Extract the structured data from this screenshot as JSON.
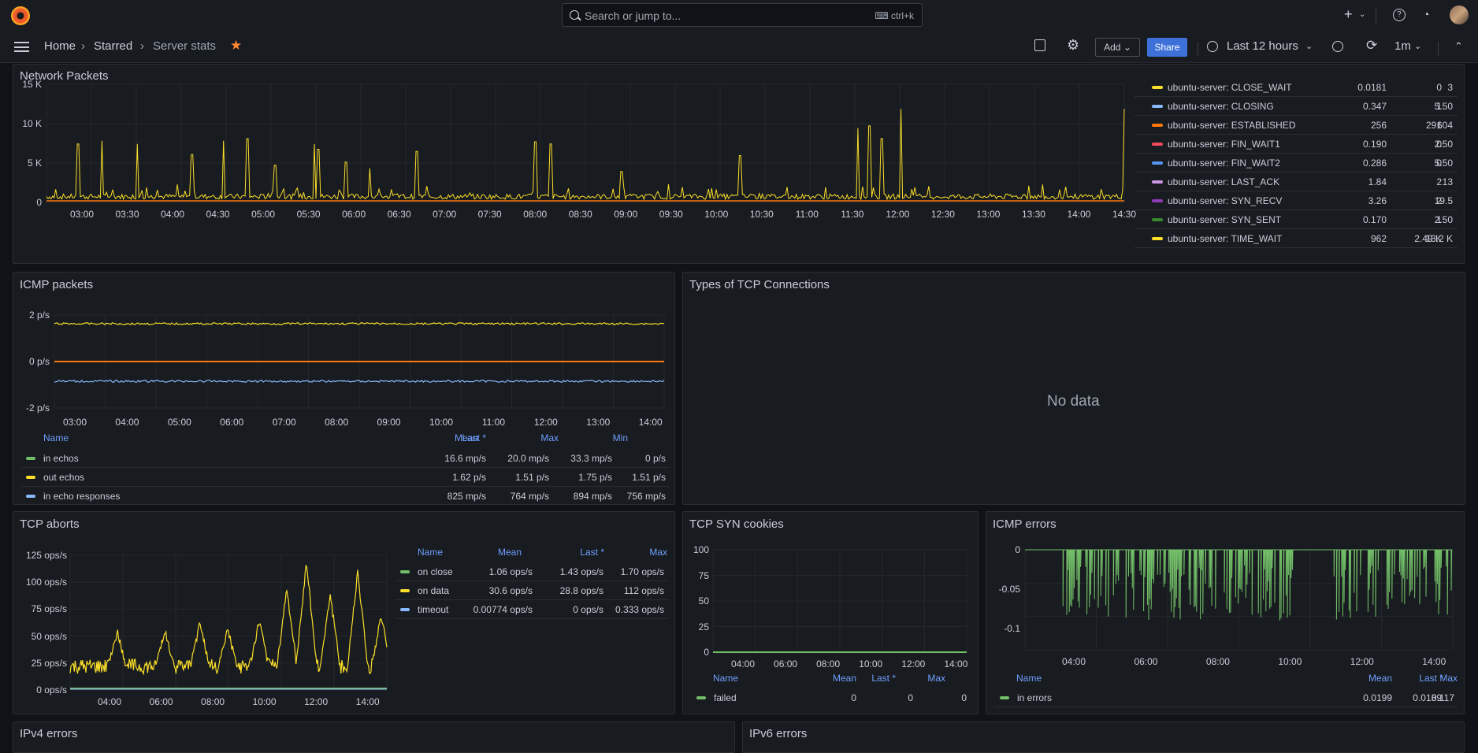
{
  "topbar": {
    "search_placeholder": "Search or jump to...",
    "search_shortcut": "ctrl+k",
    "icons": [
      "grafana-logo-icon",
      "plus-icon",
      "chevron-down-icon",
      "help-icon",
      "rss-icon",
      "avatar"
    ]
  },
  "navbar": {
    "breadcrumbs": [
      "Home",
      "Starred",
      "Server stats"
    ],
    "add_label": "Add",
    "share_label": "Share",
    "time_range": "Last 12 hours",
    "refresh_interval": "1m"
  },
  "panels": {
    "network_packets": {
      "title": "Network Packets",
      "y_ticks": [
        "15 K",
        "10 K",
        "5 K",
        "0"
      ],
      "x_ticks": [
        "03:00",
        "03:30",
        "04:00",
        "04:30",
        "05:00",
        "05:30",
        "06:00",
        "06:30",
        "07:00",
        "07:30",
        "08:00",
        "08:30",
        "09:00",
        "09:30",
        "10:00",
        "10:30",
        "11:00",
        "11:30",
        "12:00",
        "12:30",
        "13:00",
        "13:30",
        "14:00",
        "14:30"
      ],
      "legend": [
        {
          "name": "ubuntu-server: CLOSE_WAIT",
          "color": "#fade2a",
          "v1": "0.0181",
          "v2": "0",
          "v3": "3"
        },
        {
          "name": "ubuntu-server: CLOSING",
          "color": "#8ab8ff",
          "v1": "0.347",
          "v2": "1",
          "v3": "5.50"
        },
        {
          "name": "ubuntu-server: ESTABLISHED",
          "color": "#ff780a",
          "v1": "256",
          "v2": "291",
          "v3": "604"
        },
        {
          "name": "ubuntu-server: FIN_WAIT1",
          "color": "#f2495c",
          "v1": "0.190",
          "v2": "0",
          "v3": "2.50"
        },
        {
          "name": "ubuntu-server: FIN_WAIT2",
          "color": "#5794f2",
          "v1": "0.286",
          "v2": "0",
          "v3": "5.50"
        },
        {
          "name": "ubuntu-server: LAST_ACK",
          "color": "#ca95e5",
          "v1": "1.84",
          "v2": "2",
          "v3": "13"
        },
        {
          "name": "ubuntu-server: SYN_RECV",
          "color": "#8f3bb8",
          "v1": "3.26",
          "v2": "2",
          "v3": "19.5"
        },
        {
          "name": "ubuntu-server: SYN_SENT",
          "color": "#37872d",
          "v1": "0.170",
          "v2": "1",
          "v3": "2.50"
        },
        {
          "name": "ubuntu-server: TIME_WAIT",
          "color": "#fade2a",
          "v1": "962",
          "v2": "2.49 K",
          "v3": "13.2 K"
        }
      ]
    },
    "icmp_packets": {
      "title": "ICMP packets",
      "y_ticks": [
        "2 p/s",
        "0 p/s",
        "-2 p/s"
      ],
      "x_ticks": [
        "03:00",
        "04:00",
        "05:00",
        "06:00",
        "07:00",
        "08:00",
        "09:00",
        "10:00",
        "11:00",
        "12:00",
        "13:00",
        "14:00"
      ],
      "headers": [
        "Name",
        "Mean",
        "Last *",
        "Max",
        "Min"
      ],
      "rows": [
        {
          "name": "in echos",
          "color": "#73bf69",
          "mean": "16.6 mp/s",
          "last": "20.0 mp/s",
          "max": "33.3 mp/s",
          "min": "0 p/s"
        },
        {
          "name": "out echos",
          "color": "#fade2a",
          "mean": "1.62 p/s",
          "last": "1.51 p/s",
          "max": "1.75 p/s",
          "min": "1.51 p/s"
        },
        {
          "name": "in echo responses",
          "color": "#8ab8ff",
          "mean": "825 mp/s",
          "last": "764 mp/s",
          "max": "894 mp/s",
          "min": "756 mp/s"
        }
      ]
    },
    "tcp_types": {
      "title": "Types of TCP Connections",
      "no_data": "No data"
    },
    "tcp_aborts": {
      "title": "TCP aborts",
      "y_ticks": [
        "125 ops/s",
        "100 ops/s",
        "75 ops/s",
        "50 ops/s",
        "25 ops/s",
        "0 ops/s"
      ],
      "x_ticks": [
        "04:00",
        "06:00",
        "08:00",
        "10:00",
        "12:00",
        "14:00"
      ],
      "headers": [
        "Name",
        "Mean",
        "Last *",
        "Max"
      ],
      "rows": [
        {
          "name": "on close",
          "color": "#73bf69",
          "mean": "1.06 ops/s",
          "last": "1.43 ops/s",
          "max": "1.70 ops/s"
        },
        {
          "name": "on data",
          "color": "#fade2a",
          "mean": "30.6 ops/s",
          "last": "28.8 ops/s",
          "max": "112 ops/s"
        },
        {
          "name": "timeout",
          "color": "#8ab8ff",
          "mean": "0.00774 ops/s",
          "last": "0 ops/s",
          "max": "0.333 ops/s"
        }
      ]
    },
    "tcp_syn": {
      "title": "TCP SYN cookies",
      "y_ticks": [
        "100",
        "75",
        "50",
        "25",
        "0"
      ],
      "x_ticks": [
        "04:00",
        "06:00",
        "08:00",
        "10:00",
        "12:00",
        "14:00"
      ],
      "headers": [
        "Name",
        "Mean",
        "Last *",
        "Max"
      ],
      "rows": [
        {
          "name": "failed",
          "color": "#73bf69",
          "mean": "0",
          "last": "0",
          "max": "0"
        }
      ]
    },
    "icmp_errors": {
      "title": "ICMP errors",
      "y_ticks": [
        "0",
        "-0.05",
        "-0.1"
      ],
      "x_ticks": [
        "04:00",
        "06:00",
        "08:00",
        "10:00",
        "12:00",
        "14:00"
      ],
      "headers": [
        "Name",
        "Mean",
        "Last *",
        "Max"
      ],
      "rows": [
        {
          "name": "in errors",
          "color": "#73bf69",
          "mean": "0.0199",
          "last": "0.0189",
          "max": "0.117"
        }
      ]
    },
    "ipv4_errors": {
      "title": "IPv4 errors"
    },
    "ipv6_errors": {
      "title": "IPv6 errors"
    }
  }
}
